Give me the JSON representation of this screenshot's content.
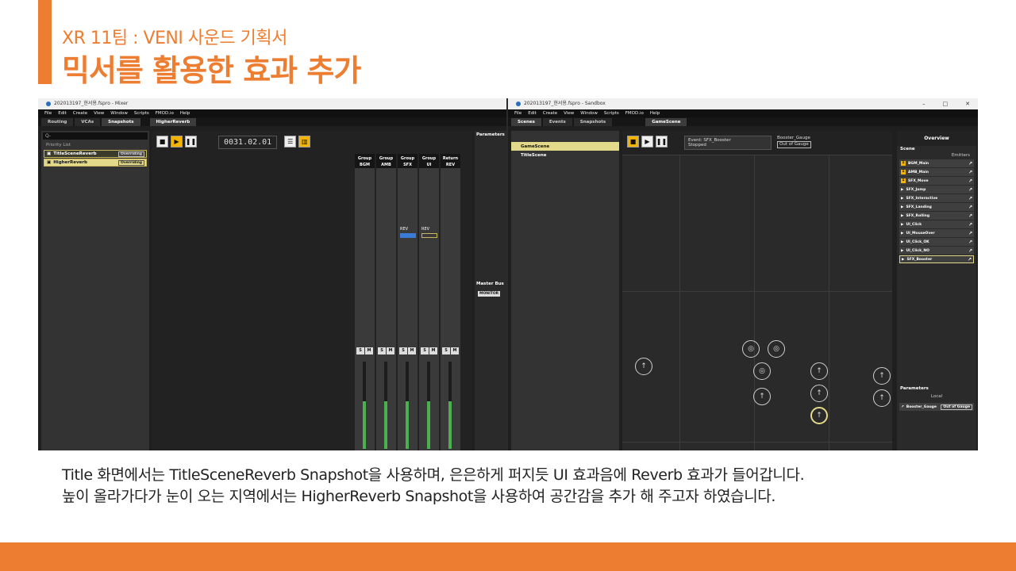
{
  "slide": {
    "subtitle": "XR 11팀 : VENI 사운드 기획서",
    "title": "믹서를 활용한 효과 추가",
    "caption_line1": "Title 화면에서는 TitleSceneReverb Snapshot을 사용하며, 은은하게 퍼지듯 UI 효과음에 Reverb 효과가 들어갑니다.",
    "caption_line2": "높이 올라가다가 눈이 오는 지역에서는 HigherReverb Snapshot을 사용하여 공간감을 추가 해 주고자 하였습니다.",
    "accent_color": "#ED7D31"
  },
  "mixer_window": {
    "title": "20201319​7_현서용.fspro - Mixer",
    "menu": [
      "File",
      "Edit",
      "Create",
      "View",
      "Window",
      "Scripts",
      "FMOD.io",
      "Help"
    ],
    "tabs": [
      "Routing",
      "VCAs",
      "Snapshots"
    ],
    "active_tab": "Snapshots",
    "editor_tab": "HigherReverb",
    "search_placeholder": "Q-",
    "priority_list_label": "Priority List",
    "snapshots": [
      {
        "name": "TitleSceneReverb",
        "mode": "Overriding"
      },
      {
        "name": "HigherReverb",
        "mode": "Overriding"
      }
    ],
    "timecode": "0031.02.01",
    "strips": [
      {
        "line1": "Group",
        "line2": "BGM"
      },
      {
        "line1": "Group",
        "line2": "AMB"
      },
      {
        "line1": "Group",
        "line2": "SFX"
      },
      {
        "line1": "Group",
        "line2": "UI"
      },
      {
        "line1": "Return",
        "line2": "REV"
      }
    ],
    "send_label": "REV",
    "parameters_label": "Parameters",
    "master_bus_label": "Master Bus",
    "monitor_label": "MONITOR"
  },
  "sandbox_window": {
    "title": "20201319​7_현서용.fspro - Sandbox",
    "menu": [
      "File",
      "Edit",
      "Create",
      "View",
      "Window",
      "Scripts",
      "FMOD.io",
      "Help"
    ],
    "tabs": [
      "Scenes",
      "Events",
      "Snapshots"
    ],
    "active_tab": "Scenes",
    "scene_tab": "GameScene",
    "scenes": [
      "GameScene",
      "TitleScene"
    ],
    "event_info_title": "Event: SFX_Booster",
    "event_info_status": "Stopped",
    "param_chip": "Booster_Gauge",
    "param_value": "Out of Gauge",
    "overview_label": "Overview",
    "scene_section": "Scene",
    "emitters_label": "Emitters",
    "emitters": [
      "BGM_Main",
      "AMB_Main",
      "SFX_Move",
      "SFX_Jump",
      "SFX_Interactive",
      "SFX_Landing",
      "SFX_Rolling",
      "UI_Click",
      "UI_MouseOver",
      "UI_Click_OK",
      "UI_Click_NO",
      "SFX_Booster"
    ],
    "parameters_section": "Parameters",
    "local_label": "Local",
    "local_param": "Booster_Gauge",
    "local_value": "Out of Gauge"
  }
}
